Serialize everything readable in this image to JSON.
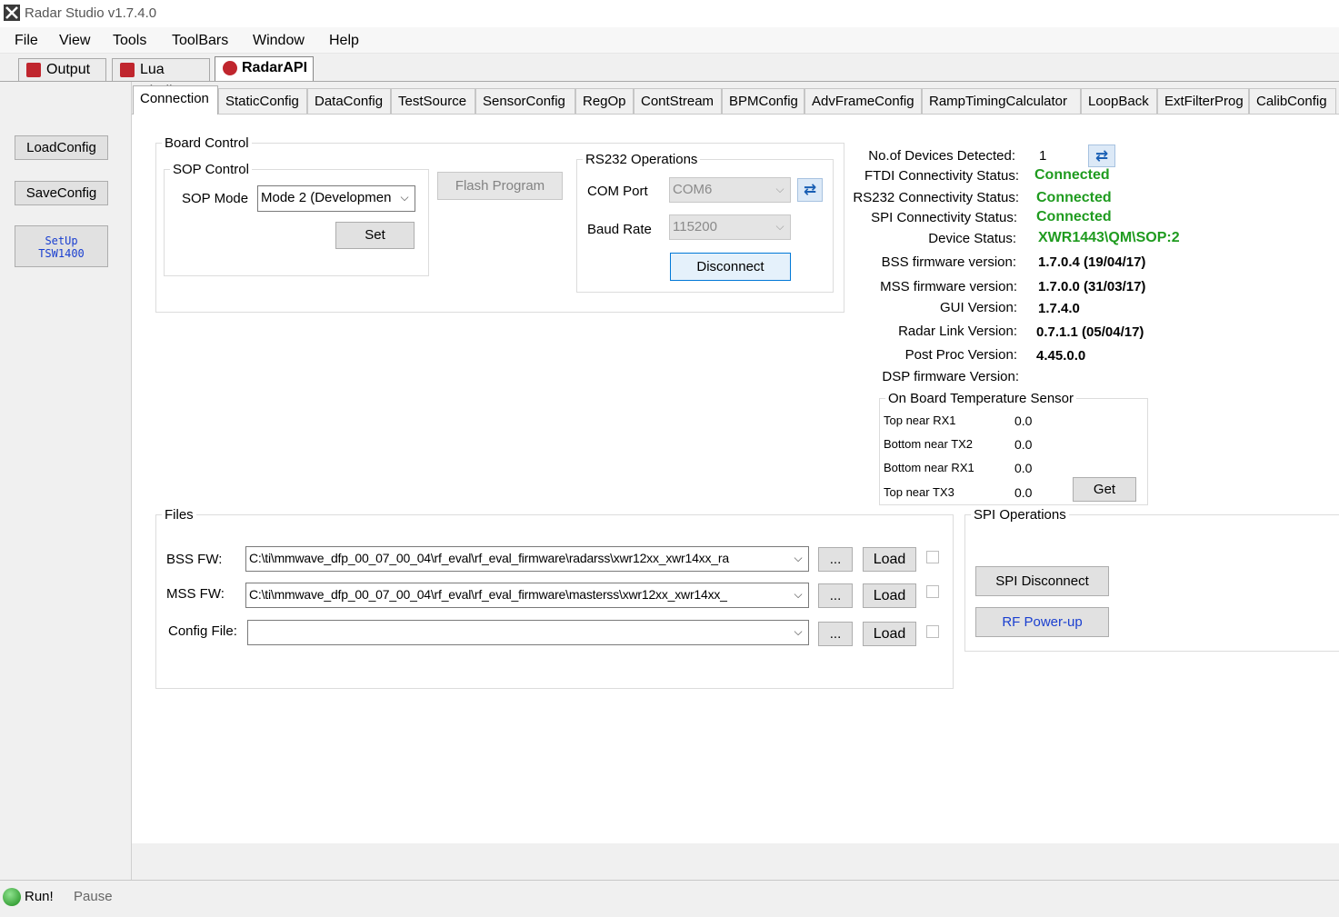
{
  "window": {
    "title": "Radar Studio v1.7.4.0"
  },
  "menu": [
    "File",
    "View",
    "Tools",
    "ToolBars",
    "Window",
    "Help"
  ],
  "doc_tabs": [
    {
      "label": "Output",
      "active": false
    },
    {
      "label": "Lua Shell",
      "active": false
    },
    {
      "label": "RadarAPI",
      "active": true
    }
  ],
  "sidebar": {
    "load_config": "LoadConfig",
    "save_config": "SaveConfig",
    "setup_line1": "SetUp",
    "setup_line2": "TSW1400"
  },
  "page_tabs": [
    "Connection",
    "StaticConfig",
    "DataConfig",
    "TestSource",
    "SensorConfig",
    "RegOp",
    "ContStream",
    "BPMConfig",
    "AdvFrameConfig",
    "RampTimingCalculator",
    "LoopBack",
    "ExtFilterProg",
    "CalibConfig"
  ],
  "board_control": {
    "legend": "Board Control",
    "sop_legend": "SOP Control",
    "sop_mode_label": "SOP Mode",
    "sop_mode_value": "Mode 2 (Developmen",
    "set_button": "Set",
    "flash_program": "Flash Program"
  },
  "rs232": {
    "legend": "RS232 Operations",
    "com_port_label": "COM Port",
    "com_port_value": "COM6",
    "baud_label": "Baud Rate",
    "baud_value": "115200",
    "disconnect": "Disconnect"
  },
  "status": {
    "devices_label": "No.of Devices Detected:",
    "devices_value": "1",
    "ftdi_label": "FTDI Connectivity Status:",
    "ftdi_value": "Connected",
    "rs232_label": "RS232 Connectivity Status:",
    "rs232_value": "Connected",
    "spi_label": "SPI Connectivity Status:",
    "spi_value": "Connected",
    "device_label": "Device Status:",
    "device_value": "XWR1443\\QM\\SOP:2",
    "bss_label": "BSS firmware version:",
    "bss_value": "1.7.0.4 (19/04/17)",
    "mss_label": "MSS firmware version:",
    "mss_value": "1.7.0.0 (31/03/17)",
    "gui_label": "GUI Version:",
    "gui_value": "1.7.4.0",
    "radarlink_label": "Radar Link Version:",
    "radarlink_value": "0.7.1.1 (05/04/17)",
    "postproc_label": "Post Proc Version:",
    "postproc_value": "4.45.0.0",
    "dsp_label": "DSP firmware Version:"
  },
  "temperature": {
    "legend": "On Board Temperature Sensor",
    "rows": [
      {
        "label": "Top near RX1",
        "value": "0.0"
      },
      {
        "label": "Bottom near TX2",
        "value": "0.0"
      },
      {
        "label": "Bottom near RX1",
        "value": "0.0"
      },
      {
        "label": "Top near TX3",
        "value": "0.0"
      }
    ],
    "get_button": "Get"
  },
  "files": {
    "legend": "Files",
    "bss_label": "BSS FW:",
    "bss_value": "C:\\ti\\mmwave_dfp_00_07_00_04\\rf_eval\\rf_eval_firmware\\radarss\\xwr12xx_xwr14xx_ra",
    "mss_label": "MSS FW:",
    "mss_value": "C:\\ti\\mmwave_dfp_00_07_00_04\\rf_eval\\rf_eval_firmware\\masterss\\xwr12xx_xwr14xx_",
    "config_label": "Config File:",
    "config_value": "",
    "browse": "...",
    "load": "Load"
  },
  "spi": {
    "legend": "SPI Operations",
    "disconnect": "SPI Disconnect",
    "rf_powerup": "RF Power-up"
  },
  "statusbar": {
    "run": "Run!",
    "pause": "Pause"
  },
  "colors": {
    "connected": "#1f9b1f",
    "rf_powerup_text": "#1a3fd0"
  }
}
